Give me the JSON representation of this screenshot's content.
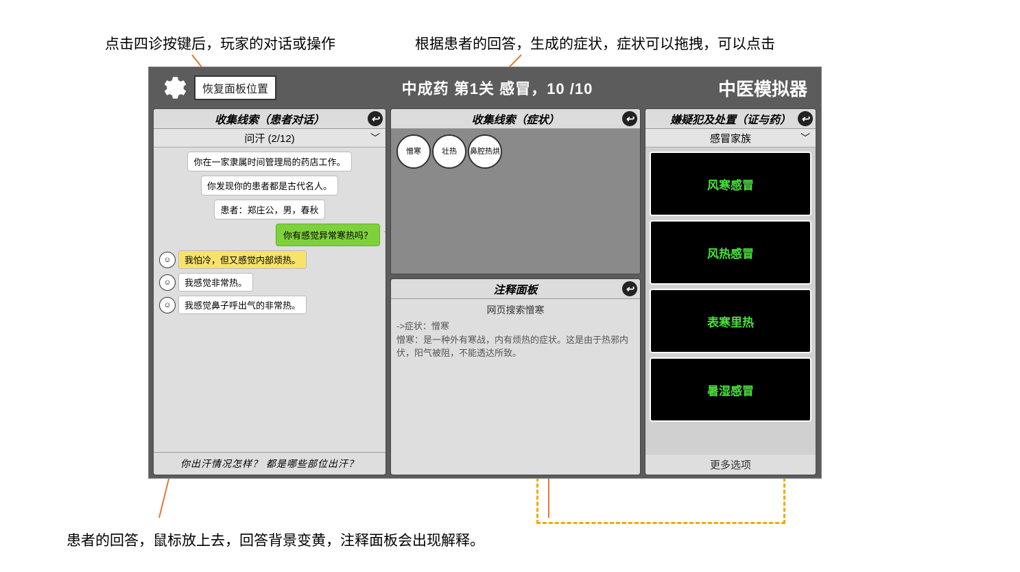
{
  "callouts": {
    "top_left": "点击四诊按键后，玩家的对话或操作",
    "top_right": "根据患者的回答，生成的症状，症状可以拖拽，可以点击",
    "bottom": "患者的回答，鼠标放上去，回答背景变黄，注释面板会出现解释。"
  },
  "topbar": {
    "reset_btn": "恢复面板位置",
    "center": "中成药 第1关 感冒，10 /10",
    "right": "中医模拟器"
  },
  "left_panel": {
    "header": "收集线索（患者对话）",
    "subheader": "问汗 (2/12)",
    "messages": {
      "m1": "你在一家隶属时间管理局的药店工作。",
      "m2": "你发现你的患者都是古代名人。",
      "m3": "患者：郑庄公，男，春秋",
      "user": "你有感觉异常寒热吗？"
    },
    "replies": {
      "r1": "我怕冷，但又感觉内部烦热。",
      "r2": "我感觉非常热。",
      "r3": "我感觉鼻子呼出气的非常热。"
    },
    "prompt": "你出汗情况怎样？ 都是哪些部位出汗？"
  },
  "mid_top": {
    "header": "收集线索（症状）",
    "symptoms": {
      "s1": "憎寒",
      "s2": "壮热",
      "s3": "鼻腔热烘"
    }
  },
  "mid_bot": {
    "header": "注释面板",
    "title": "网页搜索憎寒",
    "line1": "->症状：憎寒",
    "line2": "憎寒：是一种外有寒战，内有烦热的症状。这是由于热邪内伏，阳气被阻，不能透达所致。"
  },
  "right_panel": {
    "header": "嫌疑犯及处置（证与药）",
    "subheader": "感冒家族",
    "items": {
      "d1": "风寒感冒",
      "d2": "风热感冒",
      "d3": "表寒里热",
      "d4": "暑湿感冒"
    },
    "more": "更多选项"
  }
}
